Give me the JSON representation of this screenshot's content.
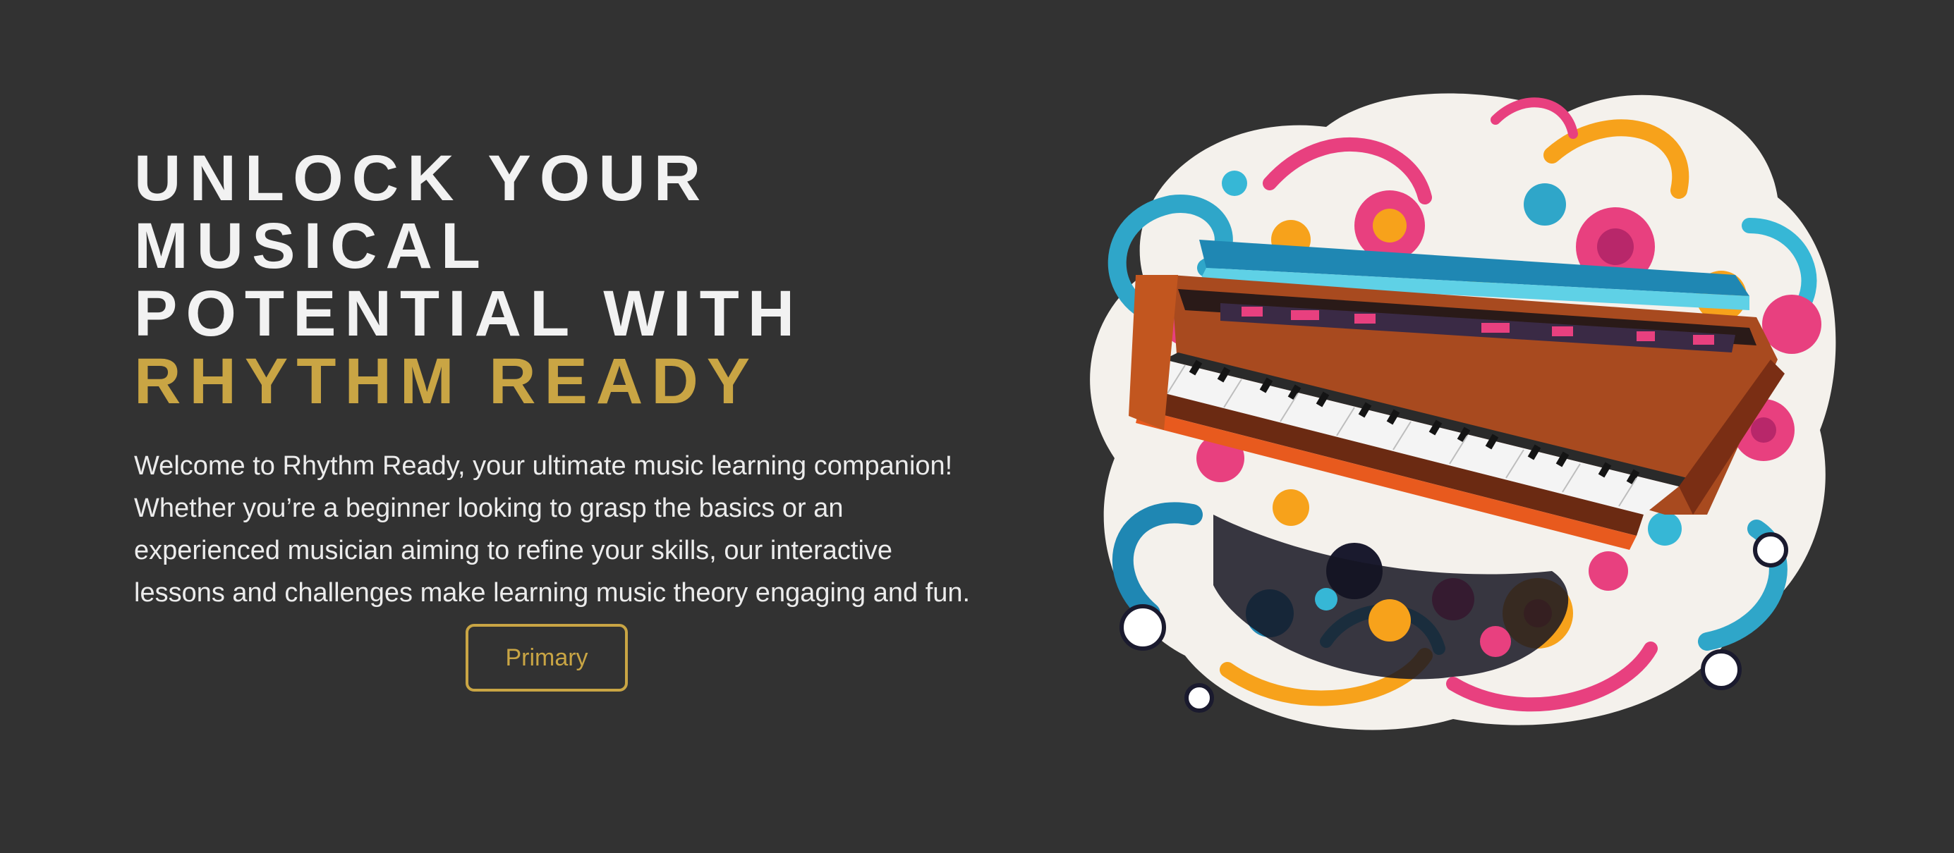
{
  "hero": {
    "headline_lines": [
      "UNLOCK YOUR",
      "MUSICAL",
      "POTENTIAL WITH"
    ],
    "headline_accent": "RHYTHM READY",
    "intro": "Welcome to Rhythm Ready, your ultimate music learning companion! Whether you’re a beginner looking to grasp the basics or an experienced musician aiming to refine your skills, our interactive lessons and challenges make learning music theory engaging and fun.",
    "cta_label": "Primary",
    "illustration_icon": "piano-illustration",
    "colors": {
      "background": "#323232",
      "accent": "#c9a544",
      "text": "#f2f2f2"
    }
  }
}
